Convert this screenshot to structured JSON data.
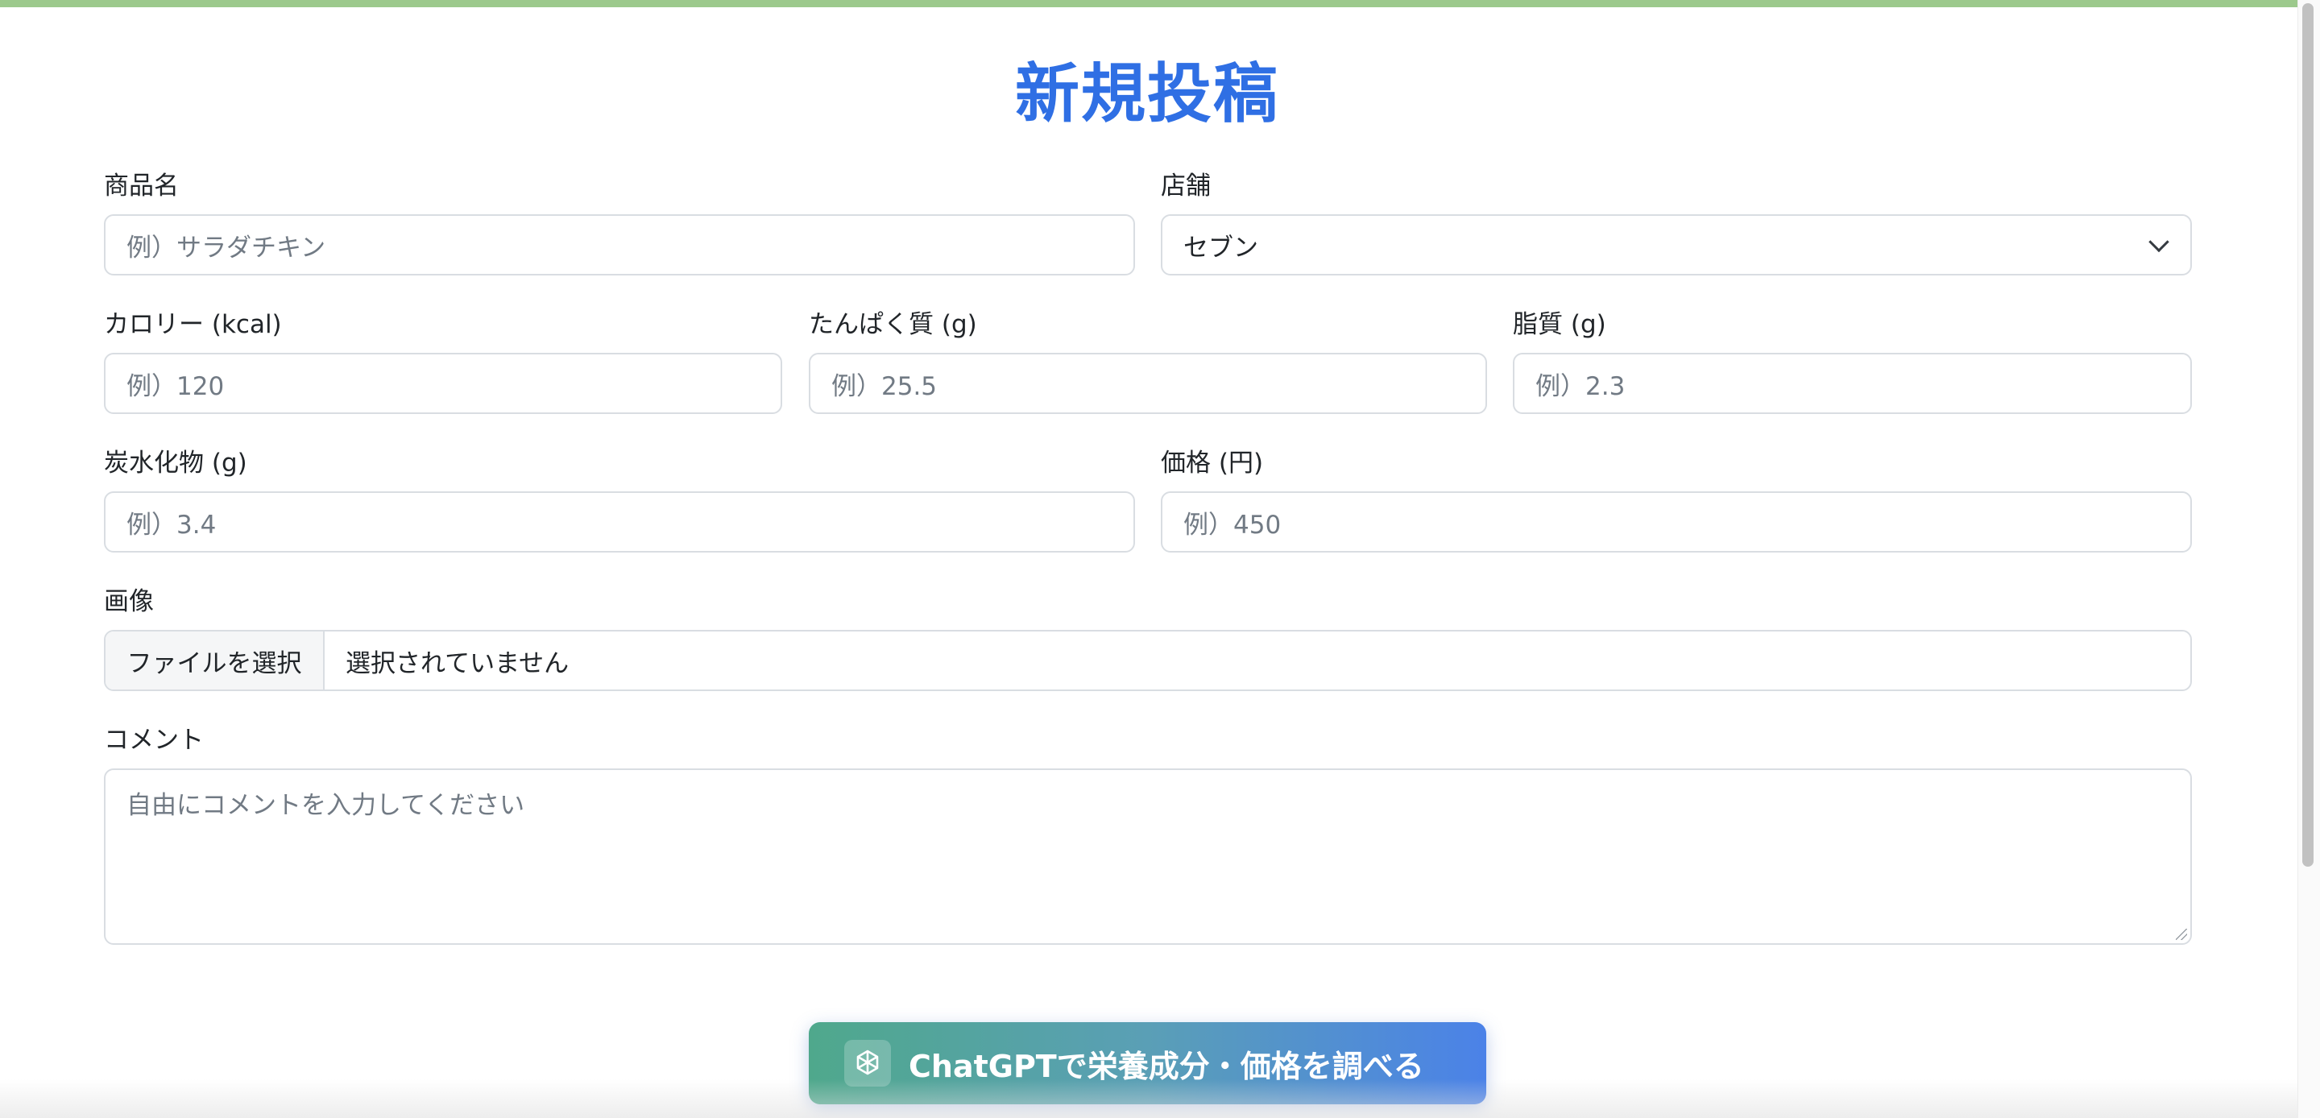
{
  "page": {
    "title": "新規投稿"
  },
  "colors": {
    "accent": "#2f6fe4",
    "top_bar": "#9cc98c",
    "button_gradient_start": "#4fa88c",
    "button_gradient_end": "#4b82e8"
  },
  "form": {
    "product_name": {
      "label": "商品名",
      "placeholder": "例）サラダチキン"
    },
    "store": {
      "label": "店舗",
      "selected": "セブン"
    },
    "calories": {
      "label": "カロリー (kcal)",
      "placeholder": "例）120"
    },
    "protein": {
      "label": "たんぱく質 (g)",
      "placeholder": "例）25.5"
    },
    "fat": {
      "label": "脂質 (g)",
      "placeholder": "例）2.3"
    },
    "carbs": {
      "label": "炭水化物 (g)",
      "placeholder": "例）3.4"
    },
    "price": {
      "label": "価格 (円)",
      "placeholder": "例）450"
    },
    "image": {
      "label": "画像",
      "button_label": "ファイルを選択",
      "status": "選択されていません"
    },
    "comment": {
      "label": "コメント",
      "placeholder": "自由にコメントを入力してください"
    }
  },
  "actions": {
    "chatgpt_button": {
      "label": "ChatGPTで栄養成分・価格を調べる",
      "icon": "openai-icon"
    }
  }
}
